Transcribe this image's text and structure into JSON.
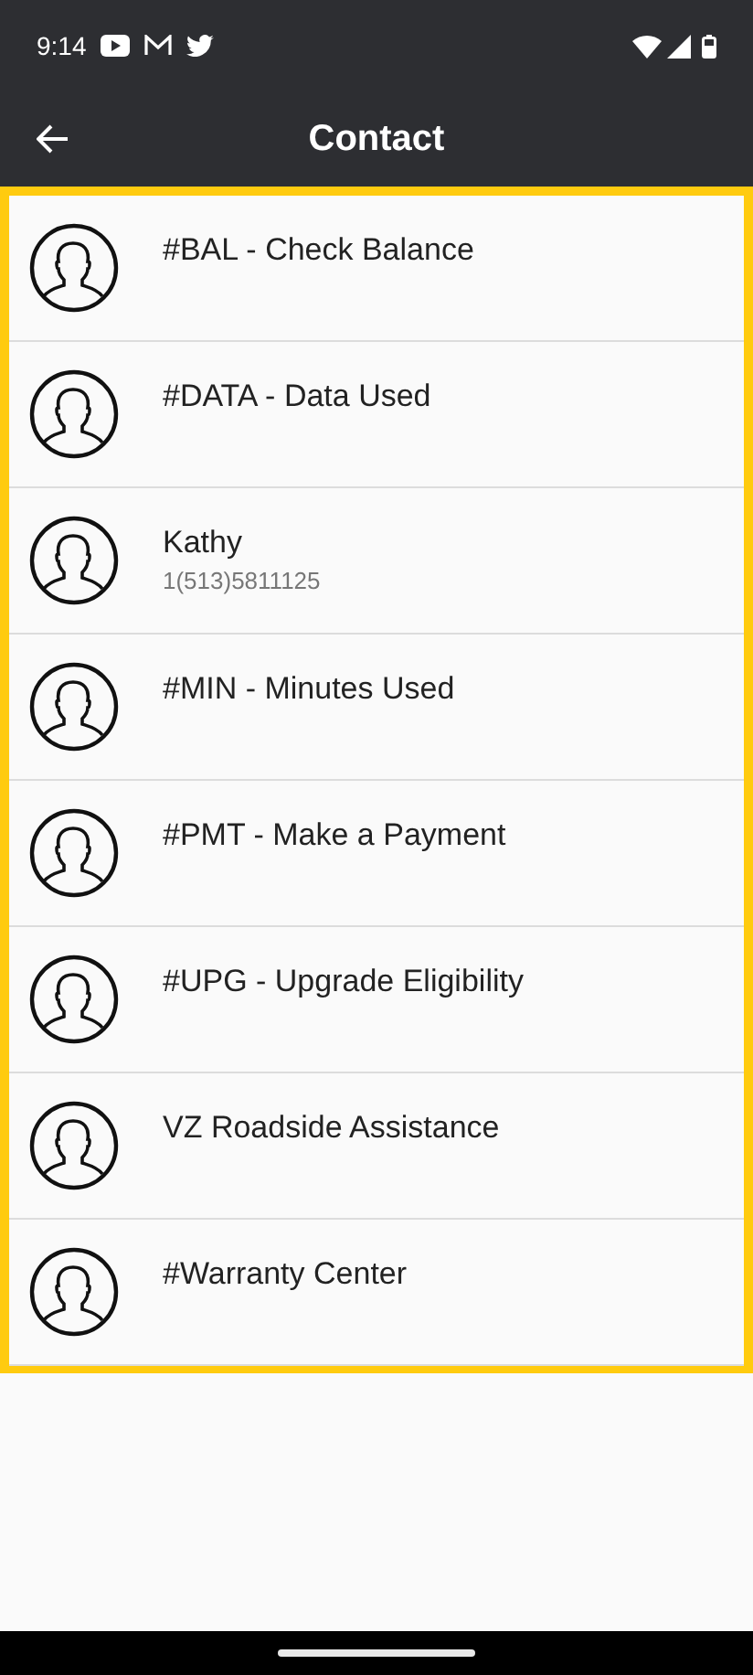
{
  "status_bar": {
    "time": "9:14"
  },
  "app_bar": {
    "title": "Contact"
  },
  "contacts": [
    {
      "name": "#BAL - Check Balance"
    },
    {
      "name": "#DATA - Data Used"
    },
    {
      "name": "Kathy",
      "number": "1(513)5811125"
    },
    {
      "name": "#MIN - Minutes Used"
    },
    {
      "name": "#PMT - Make a Payment"
    },
    {
      "name": "#UPG - Upgrade Eligibility"
    },
    {
      "name": "VZ Roadside Assistance"
    },
    {
      "name": "#Warranty Center"
    }
  ]
}
